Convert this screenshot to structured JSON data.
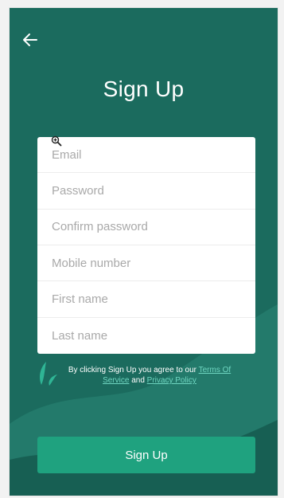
{
  "header": {
    "back_icon": "arrow-left-icon",
    "title": "Sign Up"
  },
  "form": {
    "fields": [
      {
        "name": "email",
        "placeholder": "Email",
        "value": ""
      },
      {
        "name": "password",
        "placeholder": "Password",
        "value": ""
      },
      {
        "name": "confirm_password",
        "placeholder": "Confirm password",
        "value": ""
      },
      {
        "name": "mobile",
        "placeholder": "Mobile number",
        "value": ""
      },
      {
        "name": "first_name",
        "placeholder": "First name",
        "value": ""
      },
      {
        "name": "last_name",
        "placeholder": "Last name",
        "value": ""
      }
    ]
  },
  "terms": {
    "prefix": "By clicking Sign Up you agree to our ",
    "terms_link": "Terms Of Service",
    "joiner": " and ",
    "privacy_link": "Privacy Policy"
  },
  "actions": {
    "signup_label": "Sign Up"
  },
  "colors": {
    "background": "#1b6b5e",
    "wave_light": "#237a6b",
    "wave_dark": "#175f53",
    "button": "#1fa27f",
    "link": "#6fd6c1"
  },
  "icons": {
    "cursor": "zoom-in-icon",
    "decor": "leaf-icon"
  }
}
